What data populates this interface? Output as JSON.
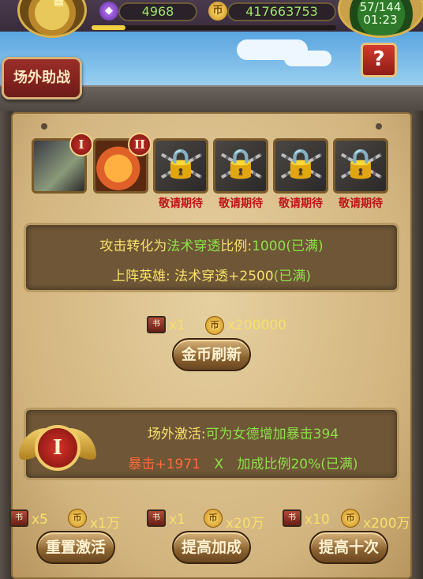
{
  "top": {
    "gems": "4968",
    "gold": "417663753",
    "stamina": "57/144",
    "timer": "01:23",
    "xp_fraction": 0.14
  },
  "title": "场外助战",
  "help_label": "?",
  "slots": [
    {
      "kind": "hero",
      "badge": "I",
      "label": ""
    },
    {
      "kind": "hero",
      "badge": "II",
      "label": ""
    },
    {
      "kind": "locked",
      "badge": "",
      "label": "敬请期待"
    },
    {
      "kind": "locked",
      "badge": "",
      "label": "敬请期待"
    },
    {
      "kind": "locked",
      "badge": "",
      "label": "敬请期待"
    },
    {
      "kind": "locked",
      "badge": "",
      "label": "敬请期待"
    }
  ],
  "info": {
    "l1_a": "攻击",
    "l1_b": "转化为",
    "l1_c": "法术穿透",
    "l1_d": "比例:",
    "l1_e": "1000(已满)",
    "l2_a": "上阵英雄: 法术穿透+2500",
    "l2_b": "(已满)"
  },
  "refresh": {
    "book_cost": "x1",
    "gold_cost": "x200000",
    "button": "金币刷新"
  },
  "bottom": {
    "badge": "I",
    "l1_a": "场外激活:",
    "l1_b": "可为女德",
    "l1_c": "增加暴击394",
    "l2_a": "暴击+1971",
    "l2_b": "X",
    "l2_c": "加成比例20%(已满)"
  },
  "actions": [
    {
      "book": "x5",
      "gold": "x1万",
      "button": "重置激活"
    },
    {
      "book": "x1",
      "gold": "x20万",
      "button": "提高加成"
    },
    {
      "book": "x10",
      "gold": "x200万",
      "button": "提高十次"
    }
  ],
  "icons": {
    "coin_glyph": "币",
    "book_glyph": "书",
    "lock_glyph": "🔒",
    "crown_glyph": "♛",
    "gem_glyph": "◆"
  }
}
